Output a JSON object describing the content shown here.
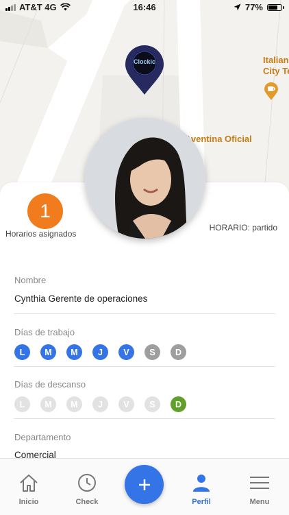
{
  "status_bar": {
    "carrier": "AT&T 4G",
    "time": "16:46",
    "battery": "77%",
    "battery_level": 0.77
  },
  "map": {
    "poi_italian_line1": "Italian",
    "poi_italian_line2": "City Te",
    "poi_aventina": "Aventina Oficial",
    "pin_logo_text": "Clockic",
    "pin_icon": "map-pin-icon",
    "cafe_icon": "coffee-cup-icon"
  },
  "profile": {
    "assigned_count": "1",
    "assigned_label": "Horarios asignados",
    "schedule_text": "HORARIO: partido"
  },
  "fields": {
    "name_label": "Nombre",
    "name_value": "Cynthia Gerente de operaciones",
    "workdays_label": "Días de trabajo",
    "restdays_label": "Días de descanso",
    "department_label": "Departamento",
    "department_value": "Comercial"
  },
  "workdays": [
    {
      "letter": "L",
      "active": true
    },
    {
      "letter": "M",
      "active": true
    },
    {
      "letter": "M",
      "active": true
    },
    {
      "letter": "J",
      "active": true
    },
    {
      "letter": "V",
      "active": true
    },
    {
      "letter": "S",
      "active": false
    },
    {
      "letter": "D",
      "active": false
    }
  ],
  "restdays": [
    {
      "letter": "L",
      "active": false
    },
    {
      "letter": "M",
      "active": false
    },
    {
      "letter": "M",
      "active": false
    },
    {
      "letter": "J",
      "active": false
    },
    {
      "letter": "V",
      "active": false
    },
    {
      "letter": "S",
      "active": false
    },
    {
      "letter": "D",
      "active": true
    }
  ],
  "tabs": {
    "home": "Inicio",
    "check": "Check",
    "profile": "Perfil",
    "menu": "Menu"
  },
  "colors": {
    "accent_blue": "#3574e6",
    "workday_inactive": "#9e9e9e",
    "restday_inactive": "#e2e2e2",
    "restday_active": "#5f9f2a",
    "badge_orange": "#f07c1e",
    "poi_text": "#c77d14",
    "pin_navy": "#262a5e"
  }
}
